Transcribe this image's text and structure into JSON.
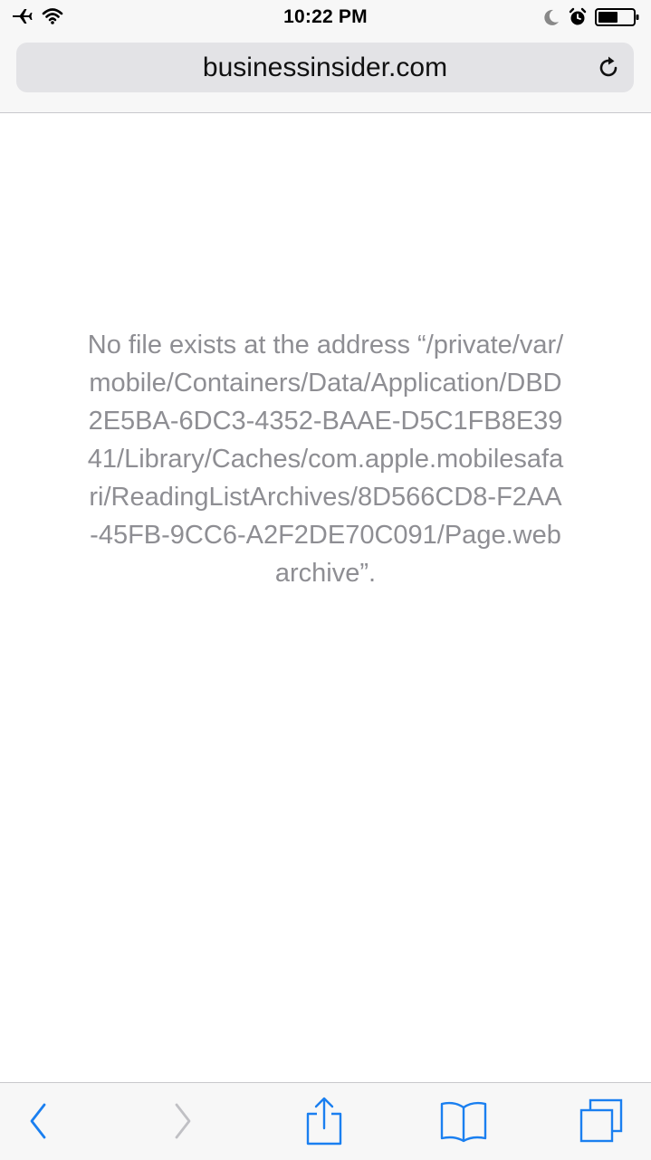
{
  "status_bar": {
    "time": "10:22 PM",
    "left_icons": [
      "airplane-icon",
      "wifi-icon"
    ],
    "right_icons": [
      "moon-icon",
      "alarm-icon",
      "battery-icon"
    ]
  },
  "address_bar": {
    "url": "businessinsider.com",
    "reload_icon": "reload-icon"
  },
  "page": {
    "error_message": "No file exists at the address “/private/var/mobile/Containers/Data/Application/DBD2E5BA-6DC3-4352-BAAE-D5C1FB8E3941/Library/Caches/com.apple.mobilesafari/ReadingListArchives/8D566CD8-F2AA-45FB-9CC6-A2F2DE70C091/Page.webarchive”."
  },
  "toolbar": {
    "buttons": [
      {
        "name": "back-button",
        "icon": "chevron-left-icon",
        "enabled": true
      },
      {
        "name": "forward-button",
        "icon": "chevron-right-icon",
        "enabled": false
      },
      {
        "name": "share-button",
        "icon": "share-icon",
        "enabled": true
      },
      {
        "name": "bookmarks-button",
        "icon": "book-icon",
        "enabled": true
      },
      {
        "name": "tabs-button",
        "icon": "tabs-icon",
        "enabled": true
      }
    ]
  },
  "colors": {
    "accent": "#1a7ff0",
    "disabled": "#c0c0c4",
    "message_text": "#8e8e93"
  }
}
